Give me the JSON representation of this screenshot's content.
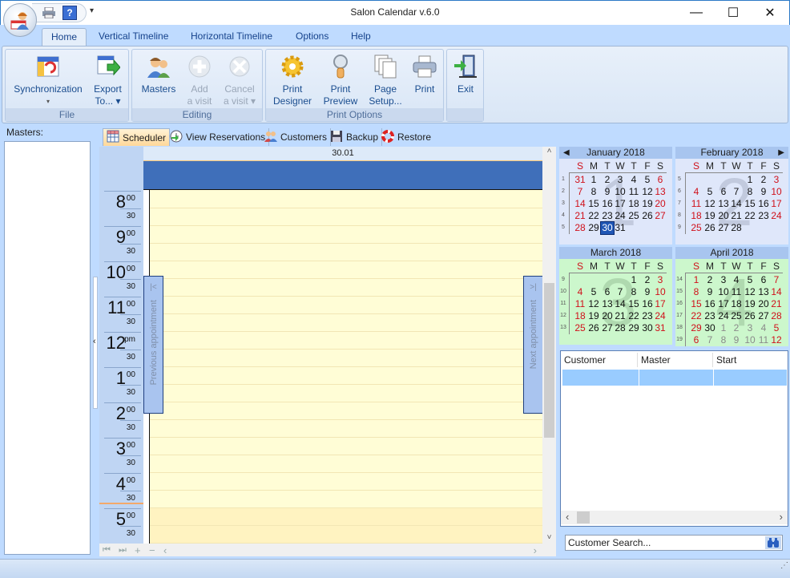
{
  "window": {
    "title": "Salon Calendar v.6.0",
    "minimize_glyph": "—",
    "maximize_glyph": "☐",
    "close_glyph": "✕"
  },
  "quick_access": {
    "icons": [
      "print-icon",
      "help-icon"
    ],
    "help_glyph": "?",
    "dropdown_glyph": "▾"
  },
  "ribbon_tabs": [
    {
      "label": "Home",
      "active": true
    },
    {
      "label": "Vertical Timeline"
    },
    {
      "label": "Horizontal Timeline"
    },
    {
      "label": "Options"
    },
    {
      "label": "Help"
    }
  ],
  "ribbon": {
    "groups": [
      {
        "label": "File",
        "buttons": [
          {
            "line1": "Synchronization",
            "line2": "▾",
            "icon": "synchronization-icon",
            "enabled": true
          },
          {
            "line1": "Export",
            "line2": "To... ▾",
            "icon": "export-icon",
            "enabled": true
          }
        ]
      },
      {
        "label": "Editing",
        "buttons": [
          {
            "line1": "Masters",
            "line2": "",
            "icon": "masters-icon",
            "enabled": true
          },
          {
            "line1": "Add",
            "line2": "a visit",
            "icon": "add-visit-icon",
            "enabled": false
          },
          {
            "line1": "Cancel",
            "line2": "a visit ▾",
            "icon": "cancel-visit-icon",
            "enabled": false
          }
        ]
      },
      {
        "label": "Print Options",
        "buttons": [
          {
            "line1": "Print",
            "line2": "Designer",
            "icon": "gear-icon",
            "enabled": true
          },
          {
            "line1": "Print",
            "line2": "Preview",
            "icon": "magnifier-icon",
            "enabled": true
          },
          {
            "line1": "Page",
            "line2": "Setup...",
            "icon": "pages-icon",
            "enabled": true
          },
          {
            "line1": "Print",
            "line2": "",
            "icon": "printer-icon",
            "enabled": true
          }
        ]
      },
      {
        "label": "",
        "buttons": [
          {
            "line1": "Exit",
            "line2": "",
            "icon": "exit-door-icon",
            "enabled": true
          }
        ]
      }
    ]
  },
  "masters_panel": {
    "label": "Masters:",
    "items": []
  },
  "scheduler_tabs": [
    {
      "label": "Scheduler",
      "icon": "grid-icon",
      "active": true
    },
    {
      "label": "View Reservations",
      "icon": "clock-arrow-icon"
    },
    {
      "label": "Customers",
      "icon": "people-icon"
    },
    {
      "label": "Backup",
      "icon": "floppy-icon"
    },
    {
      "label": "Restore",
      "icon": "lifebuoy-icon"
    }
  ],
  "scheduler": {
    "date_header": "30.01",
    "hours": [
      {
        "h": "8",
        "m": "00",
        "half": "30"
      },
      {
        "h": "9",
        "m": "00",
        "half": "30"
      },
      {
        "h": "10",
        "m": "00",
        "half": "30"
      },
      {
        "h": "11",
        "m": "00",
        "half": "30"
      },
      {
        "h": "12",
        "m": "pm",
        "half": "30"
      },
      {
        "h": "1",
        "m": "00",
        "half": "30"
      },
      {
        "h": "2",
        "m": "00",
        "half": "30"
      },
      {
        "h": "3",
        "m": "00",
        "half": "30"
      },
      {
        "h": "4",
        "m": "00",
        "half": "30"
      },
      {
        "h": "5",
        "m": "00",
        "half": "30"
      }
    ],
    "prev_appointment": "Previous appointment",
    "next_appointment": "Next appointment",
    "prev_glyph": "K",
    "next_glyph": "K",
    "nav_buttons": [
      "⏮",
      "⏭",
      "+",
      "−",
      "‹"
    ],
    "scroll_right": "›",
    "scroll_up": "˄",
    "scroll_down": "˅"
  },
  "calendar": {
    "dow": [
      "S",
      "M",
      "T",
      "W",
      "T",
      "F",
      "S"
    ],
    "selected": "2018-01-30",
    "months": [
      {
        "title": "January 2018",
        "big": "1",
        "weeks": [
          1,
          2,
          3,
          4,
          5
        ],
        "rows": [
          [
            "31",
            "1",
            "2",
            "3",
            "4",
            "5",
            "6"
          ],
          [
            "7",
            "8",
            "9",
            "10",
            "11",
            "12",
            "13"
          ],
          [
            "14",
            "15",
            "16",
            "17",
            "18",
            "19",
            "20"
          ],
          [
            "21",
            "22",
            "23",
            "24",
            "25",
            "26",
            "27"
          ],
          [
            "28",
            "29",
            "30",
            "31",
            "",
            "",
            ""
          ]
        ]
      },
      {
        "title": "February 2018",
        "big": "2",
        "weeks": [
          5,
          6,
          7,
          8,
          9
        ],
        "rows": [
          [
            "",
            "",
            "",
            "",
            "1",
            "2",
            "3"
          ],
          [
            "4",
            "5",
            "6",
            "7",
            "8",
            "9",
            "10"
          ],
          [
            "11",
            "12",
            "13",
            "14",
            "15",
            "16",
            "17"
          ],
          [
            "18",
            "19",
            "20",
            "21",
            "22",
            "23",
            "24"
          ],
          [
            "25",
            "26",
            "27",
            "28",
            "",
            "",
            ""
          ]
        ]
      },
      {
        "title": "March 2018",
        "big": "3",
        "weeks": [
          9,
          10,
          11,
          12,
          13
        ],
        "rows": [
          [
            "",
            "",
            "",
            "",
            "1",
            "2",
            "3"
          ],
          [
            "4",
            "5",
            "6",
            "7",
            "8",
            "9",
            "10"
          ],
          [
            "11",
            "12",
            "13",
            "14",
            "15",
            "16",
            "17"
          ],
          [
            "18",
            "19",
            "20",
            "21",
            "22",
            "23",
            "24"
          ],
          [
            "25",
            "26",
            "27",
            "28",
            "29",
            "30",
            "31"
          ]
        ]
      },
      {
        "title": "April 2018",
        "big": "4",
        "weeks": [
          14,
          15,
          16,
          17,
          18,
          19
        ],
        "rows": [
          [
            "1",
            "2",
            "3",
            "4",
            "5",
            "6",
            "7"
          ],
          [
            "8",
            "9",
            "10",
            "11",
            "12",
            "13",
            "14"
          ],
          [
            "15",
            "16",
            "17",
            "18",
            "19",
            "20",
            "21"
          ],
          [
            "22",
            "23",
            "24",
            "25",
            "26",
            "27",
            "28"
          ],
          [
            "29",
            "30",
            "1",
            "2",
            "3",
            "4",
            "5"
          ],
          [
            "6",
            "7",
            "8",
            "9",
            "10",
            "11",
            "12"
          ]
        ]
      }
    ],
    "prev_glyph": "◀",
    "next_glyph": "▶"
  },
  "appointments_list": {
    "columns": [
      "Customer",
      "Master",
      "Start"
    ],
    "rows": [
      [
        "",
        "",
        ""
      ]
    ],
    "scroll_left": "‹",
    "scroll_right": "›"
  },
  "search": {
    "placeholder": "Customer Search..."
  },
  "colors": {
    "accent": "#3f6fba",
    "weekend": "#d0101a",
    "grid_bg": "#fffdd6",
    "selected_day": "#1f56b5",
    "list_selection": "#99ccff"
  }
}
